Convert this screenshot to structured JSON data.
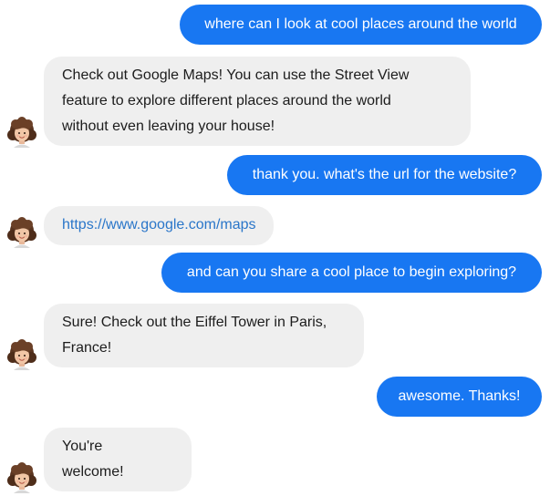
{
  "colors": {
    "outgoing_bubble": "#1877f2",
    "outgoing_text": "#ffffff",
    "incoming_bubble": "#efefef",
    "incoming_text": "#1c1c1c",
    "link": "#2a76c9"
  },
  "avatar_icon": "memoji-avatar-icon",
  "messages": [
    {
      "sender": "user",
      "text": "where can I look at cool places around the world"
    },
    {
      "sender": "bot",
      "lines": [
        "Check out Google Maps! You can use the Street View",
        "feature to explore different places around the world",
        "without even leaving your house!"
      ]
    },
    {
      "sender": "user",
      "text": "thank you. what's the url for the website?"
    },
    {
      "sender": "bot",
      "link": "https://www.google.com/maps"
    },
    {
      "sender": "user",
      "text": "and can you share a cool place to begin exploring?"
    },
    {
      "sender": "bot",
      "lines": [
        "Sure! Check out the Eiffel Tower in Paris,",
        "France!"
      ]
    },
    {
      "sender": "user",
      "text": "awesome. Thanks!"
    },
    {
      "sender": "bot",
      "lines": [
        "You're",
        "welcome!"
      ]
    }
  ]
}
